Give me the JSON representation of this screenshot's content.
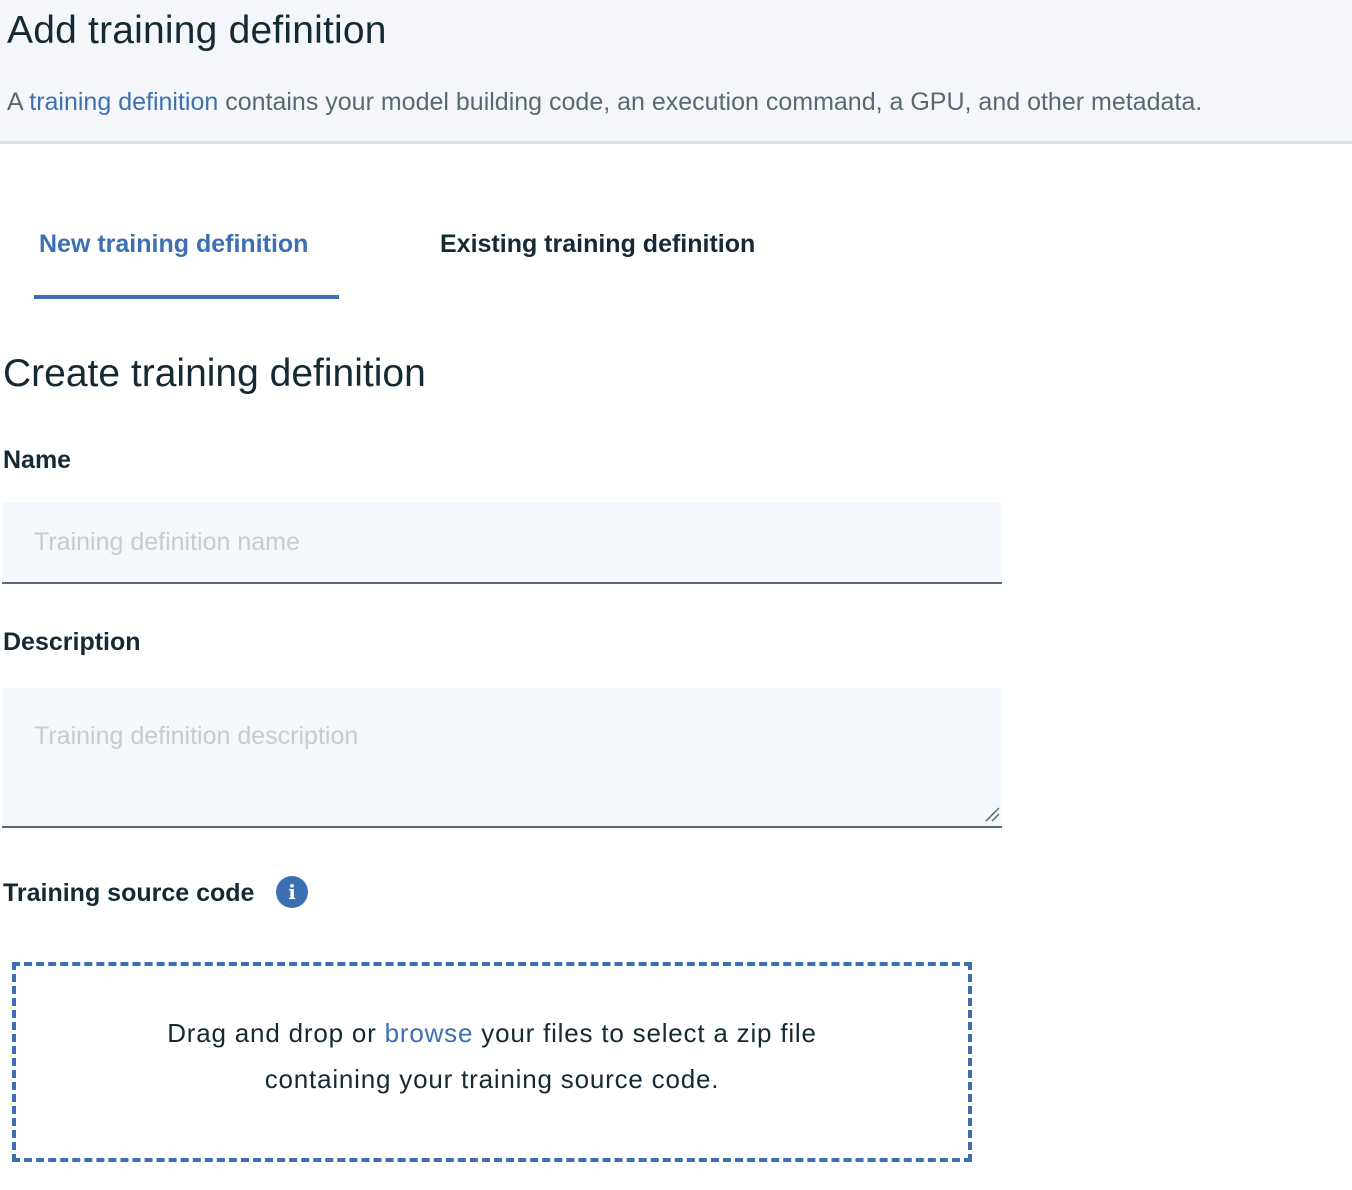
{
  "header": {
    "title": "Add training definition",
    "desc_prefix": "A",
    "desc_link": "training definition",
    "desc_suffix": "contains your model building code,  an execution command, a GPU, and other metadata."
  },
  "tabs": [
    {
      "label": "New training definition",
      "selected": true
    },
    {
      "label": "Existing training definition",
      "selected": false
    }
  ],
  "form": {
    "section_title": "Create training definition",
    "name_label": "Name",
    "name_placeholder": "Training definition name",
    "name_value": "",
    "description_label": "Description",
    "description_placeholder": "Training definition description",
    "description_value": "",
    "source_label": "Training source code",
    "info_icon": "info-icon",
    "dropzone_prefix": "Drag and drop or",
    "dropzone_link": "browse",
    "dropzone_suffix": "your files to select a zip file",
    "dropzone_line2": "containing your training source code."
  },
  "colors": {
    "accent": "#3d70b2",
    "text": "#152935",
    "header_bg": "#f4f6fa"
  }
}
